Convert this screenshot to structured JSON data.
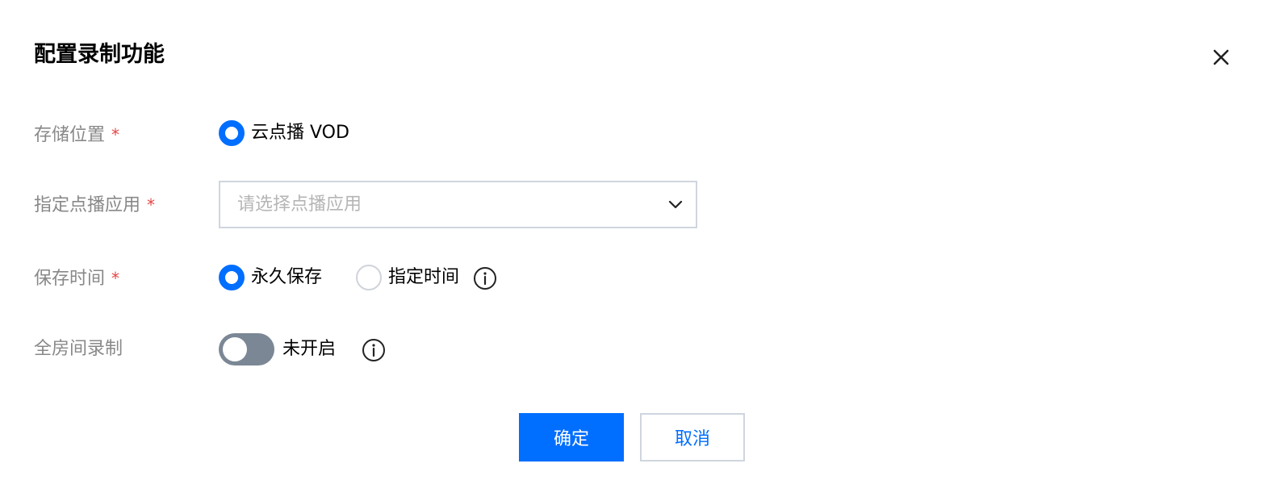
{
  "dialog": {
    "title": "配置录制功能",
    "close_icon": "close-icon"
  },
  "form": {
    "storage": {
      "label": "存储位置",
      "required_mark": "*",
      "option": "云点播 VOD",
      "selected": true
    },
    "vod_app": {
      "label": "指定点播应用",
      "required_mark": "*",
      "placeholder": "请选择点播应用",
      "icon": "chevron-down-icon"
    },
    "retention": {
      "label": "保存时间",
      "required_mark": "*",
      "options": [
        {
          "label": "永久保存",
          "selected": true
        },
        {
          "label": "指定时间",
          "selected": false
        }
      ],
      "info_icon": "info-icon"
    },
    "room_recording": {
      "label": "全房间录制",
      "toggle_on": false,
      "status_text": "未开启",
      "info_icon": "info-icon"
    }
  },
  "footer": {
    "confirm_label": "确定",
    "cancel_label": "取消"
  },
  "colors": {
    "primary": "#006eff",
    "required": "#e54545",
    "label": "#888888",
    "toggle_off": "#7b8795"
  }
}
